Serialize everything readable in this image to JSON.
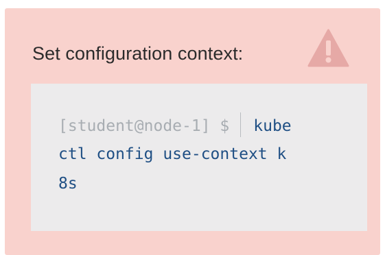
{
  "panel": {
    "title": "Set configuration context:",
    "icon": "warning-icon",
    "colors": {
      "background": "#f9d2cd",
      "code_background": "#ecebec",
      "command": "#1f4f84",
      "prompt": "#a8adb2",
      "icon": "#e6a9a6"
    }
  },
  "terminal": {
    "prompt": "[student@node-1] $",
    "command_lines": [
      "kube",
      "ctl config use-context k",
      "8s"
    ]
  }
}
